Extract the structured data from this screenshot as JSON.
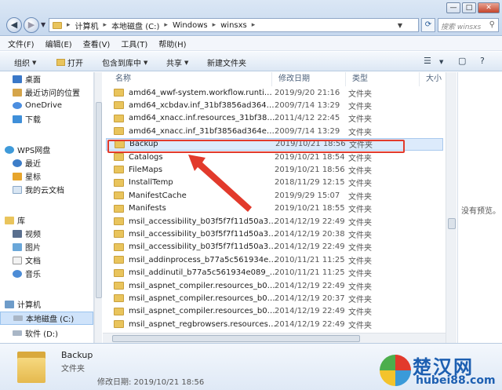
{
  "window": {
    "address": [
      "计算机",
      "本地磁盘 (C:)",
      "Windows",
      "winsxs"
    ],
    "search_placeholder": "搜索 winsxs",
    "controls": {
      "minimize": "—",
      "maximize": "□",
      "close": "✕"
    }
  },
  "menu": [
    "文件(F)",
    "编辑(E)",
    "查看(V)",
    "工具(T)",
    "帮助(H)"
  ],
  "toolbar": {
    "organize": "组织",
    "open": "打开",
    "include_in_library": "包含到库中",
    "share": "共享",
    "new_folder": "新建文件夹"
  },
  "nav": {
    "items": [
      {
        "label": "桌面",
        "icon": "desktop-icon"
      },
      {
        "label": "最近访问的位置",
        "icon": "recent-places-icon"
      },
      {
        "label": "OneDrive",
        "icon": "onedrive-icon"
      },
      {
        "label": "下载",
        "icon": "downloads-icon"
      },
      {
        "label": "WPS网盘",
        "icon": "wps-cloud-icon"
      },
      {
        "label": "最近",
        "icon": "clock-icon"
      },
      {
        "label": "星标",
        "icon": "star-icon"
      },
      {
        "label": "我的云文档",
        "icon": "cloud-doc-icon"
      },
      {
        "label": "库",
        "icon": "library-icon"
      },
      {
        "label": "视频",
        "icon": "video-icon"
      },
      {
        "label": "图片",
        "icon": "pictures-icon"
      },
      {
        "label": "文档",
        "icon": "documents-icon"
      },
      {
        "label": "音乐",
        "icon": "music-icon"
      },
      {
        "label": "计算机",
        "icon": "computer-icon"
      },
      {
        "label": "本地磁盘 (C:)",
        "icon": "drive-c-icon"
      },
      {
        "label": "软件 (D:)",
        "icon": "drive-d-icon"
      }
    ]
  },
  "columns": {
    "name": "名称",
    "date": "修改日期",
    "type": "类型",
    "size": "大小"
  },
  "files": [
    {
      "name": "amd64_wwf-system.workflow.runtime...",
      "date": "2019/9/20 21:16",
      "type": "文件夹"
    },
    {
      "name": "amd64_xcbdav.inf_31bf3856ad364e3...",
      "date": "2009/7/14 13:29",
      "type": "文件夹"
    },
    {
      "name": "amd64_xnacc.inf.resources_31bf3856...",
      "date": "2011/4/12 22:45",
      "type": "文件夹"
    },
    {
      "name": "amd64_xnacc.inf_31bf3856ad364e35_...",
      "date": "2009/7/14 13:29",
      "type": "文件夹"
    },
    {
      "name": "Backup",
      "date": "2019/10/21 18:56",
      "type": "文件夹"
    },
    {
      "name": "Catalogs",
      "date": "2019/10/21 18:54",
      "type": "文件夹"
    },
    {
      "name": "FileMaps",
      "date": "2019/10/21 18:56",
      "type": "文件夹"
    },
    {
      "name": "InstallTemp",
      "date": "2018/11/29 12:15",
      "type": "文件夹"
    },
    {
      "name": "ManifestCache",
      "date": "2019/9/29 15:07",
      "type": "文件夹"
    },
    {
      "name": "Manifests",
      "date": "2019/10/21 18:55",
      "type": "文件夹"
    },
    {
      "name": "msil_accessibility_b03f5f7f11d50a3a_...",
      "date": "2014/12/19 22:49",
      "type": "文件夹"
    },
    {
      "name": "msil_accessibility_b03f5f7f11d50a3a_...",
      "date": "2014/12/19 20:38",
      "type": "文件夹"
    },
    {
      "name": "msil_accessibility_b03f5f7f11d50a3a_...",
      "date": "2014/12/19 22:49",
      "type": "文件夹"
    },
    {
      "name": "msil_addinprocess_b77a5c561934e08...",
      "date": "2010/11/21 11:25",
      "type": "文件夹"
    },
    {
      "name": "msil_addinutil_b77a5c561934e089_6.1...",
      "date": "2010/11/21 11:25",
      "type": "文件夹"
    },
    {
      "name": "msil_aspnet_compiler.resources_b03f...",
      "date": "2014/12/19 22:49",
      "type": "文件夹"
    },
    {
      "name": "msil_aspnet_compiler.resources_b03f...",
      "date": "2014/12/19 20:37",
      "type": "文件夹"
    },
    {
      "name": "msil_aspnet_compiler.resources_b03f...",
      "date": "2014/12/19 22:49",
      "type": "文件夹"
    },
    {
      "name": "msil_aspnet_regbrowsers.resources_...",
      "date": "2014/12/19 22:49",
      "type": "文件夹"
    }
  ],
  "selected_index": 4,
  "preview": {
    "text": "没有预览。"
  },
  "details": {
    "name": "Backup",
    "type": "文件夹",
    "modified": "修改日期: 2019/10/21 18:56"
  },
  "watermark": {
    "title": "楚汉网",
    "url": "hubei88.com"
  },
  "colors": {
    "annotation_red": "#e23a2c",
    "selection_blue": "#dceafb"
  }
}
